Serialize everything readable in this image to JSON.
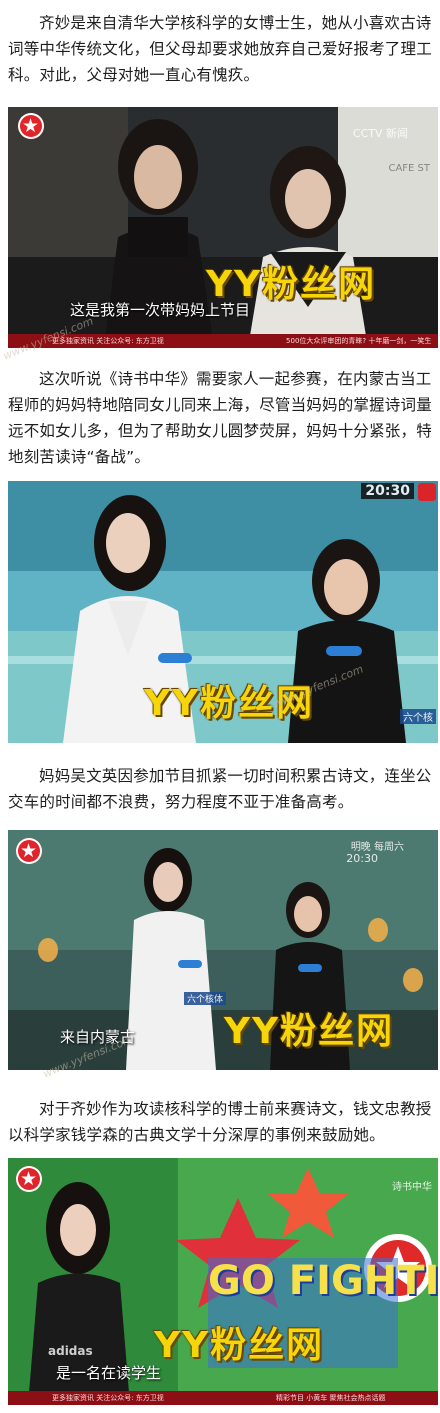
{
  "paragraphs": [
    "齐妙是来自清华大学核科学的女博士生，她从小喜欢古诗词等中华传统文化，但父母却要求她放弃自己爱好报考了理工科。对此，父母对她一直心有愧疚。",
    "这次听说《诗书中华》需要家人一起参赛，在内蒙古当工程师的妈妈特地陪同女儿同来上海，尽管当妈妈的掌握诗词量远不如女儿多，但为了帮助女儿圆梦荧屏，妈妈十分紧张，特地刻苦读诗“备战”。",
    "妈妈吴文英因参加节目抓紧一切时间积累古诗文，连坐公交车的时间都不浪费，努力程度不亚于准备高考。",
    "对于齐妙作为攻读核科学的博士前来赛诗文，钱文忠教授以科学家钱学森的古典文学十分深厚的事例来鼓励她。"
  ],
  "watermark_text": "YY粉丝网",
  "site_watermark": "www.yyfensi.com",
  "frames": [
    {
      "subtitle": "这是我第一次带妈妈上节目",
      "corner": "CCTV 新闻",
      "cafe_sign": "CAFE ST",
      "ticker_left": "更多独家资讯 关注公众号: 东方卫视",
      "ticker_mid": "500位大众评审团的青睐? 十年磨一剑，一笑生"
    },
    {
      "time": "20:30",
      "badge": "六个核",
      "corner_small": "六个核"
    },
    {
      "subtitle": "来自内蒙古",
      "time": "20:30",
      "corner": "明晚 每周六",
      "name_tag": "六个核体"
    },
    {
      "subtitle": "是一名在读学生",
      "corner": "诗书中华",
      "ticker_left": "更多独家资讯 关注公众号: 东方卫视",
      "ticker_mid": "精彩节目 小黄车  聚焦社会热点话题",
      "shirt": "adidas",
      "wall_text": "GO FIGHTING"
    }
  ],
  "colors": {
    "watermark": "#f6d60a",
    "ticker": "#8b0f14",
    "logo_red": "#e0242a"
  }
}
